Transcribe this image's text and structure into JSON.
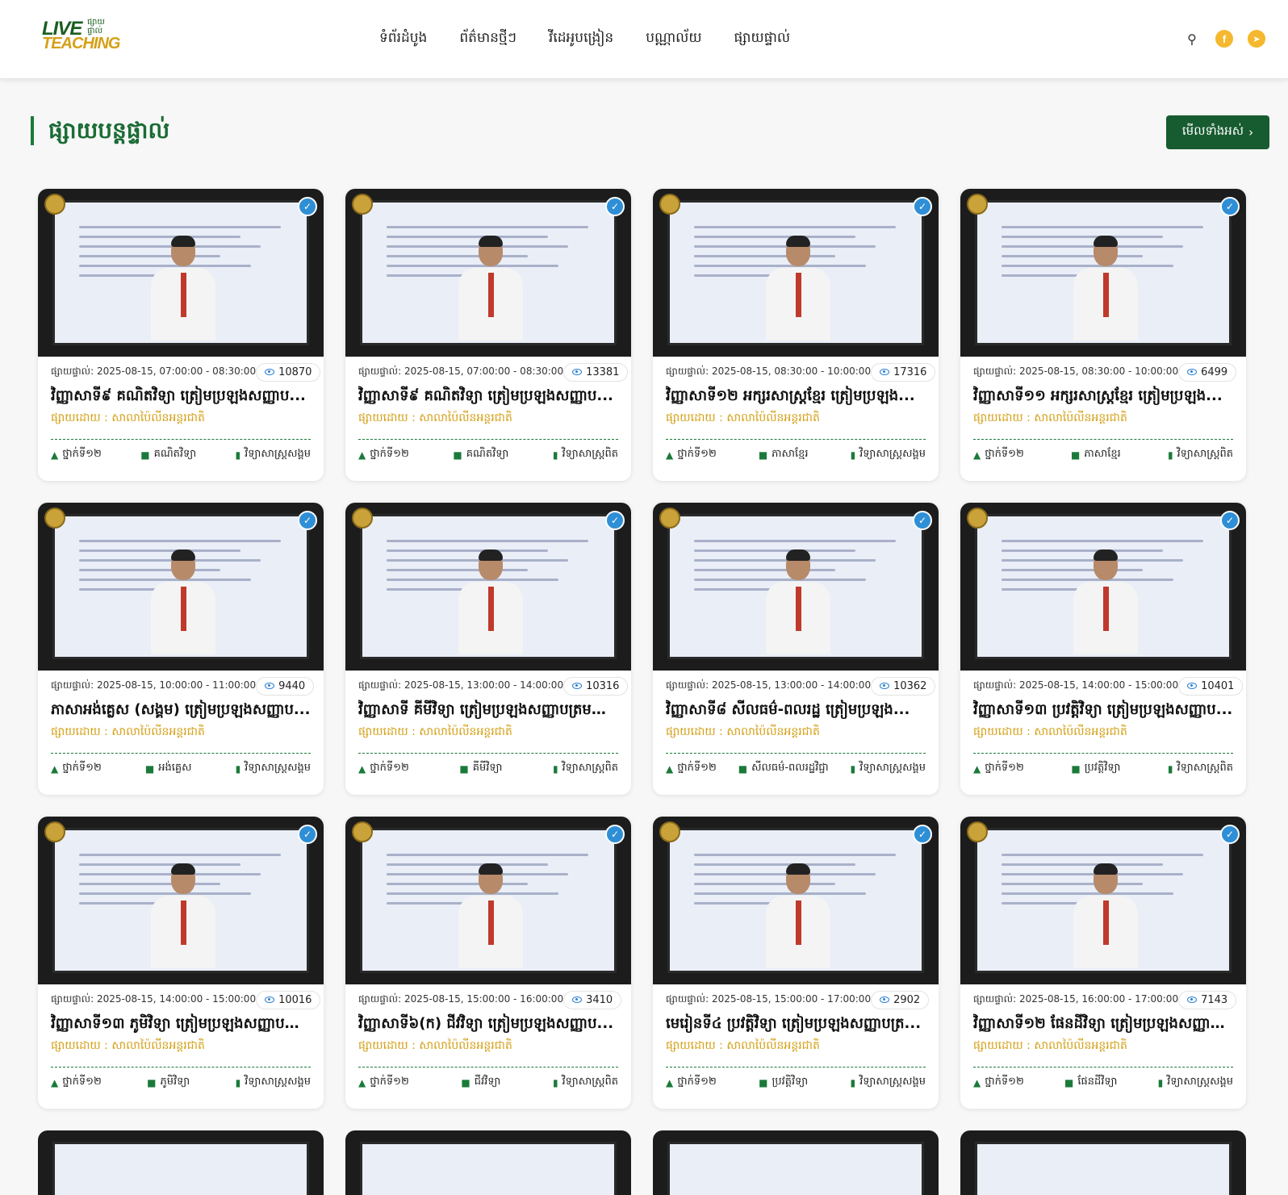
{
  "header": {
    "logo": {
      "line1": "LIVE",
      "line2": "TEACHING",
      "khmer": "ផ្សាយ ផ្ទាល់"
    },
    "nav": [
      "ទំព័រដំបូង",
      "ព័ត៌មានថ្មីៗ",
      "វីដេអូបង្រៀន",
      "បណ្ណាល័យ",
      "ផ្សាយផ្ទាល់"
    ],
    "icons": [
      "search-icon",
      "facebook-icon",
      "telegram-icon"
    ]
  },
  "section": {
    "title": "ផ្សាយបន្តផ្ទាល់",
    "view_all": "មើលទាំងអស់"
  },
  "cards": [
    {
      "time": "ផ្សាយផ្ទាល់: 2025-08-15, 07:00:00 - 08:30:00",
      "views": "10870",
      "title": "វិញ្ញាសាទី៩ គណិតវិទ្យា ត្រៀមប្រឡងសញ្ញាប...",
      "by": "ផ្សាយដោយ : សាលាប៉ៃលីនអន្តរជាតិ",
      "grade": "ថ្នាក់ទី១២",
      "subject": "គណិតវិទ្យា",
      "track": "វិទ្យាសាស្ត្រសង្គម"
    },
    {
      "time": "ផ្សាយផ្ទាល់: 2025-08-15, 07:00:00 - 08:30:00",
      "views": "13381",
      "title": "វិញ្ញាសាទី៩ គណិតវិទ្យា ត្រៀមប្រឡងសញ្ញាប...",
      "by": "ផ្សាយដោយ : សាលាប៉ៃលីនអន្តរជាតិ",
      "grade": "ថ្នាក់ទី១២",
      "subject": "គណិតវិទ្យា",
      "track": "វិទ្យាសាស្ត្រពិត"
    },
    {
      "time": "ផ្សាយផ្ទាល់: 2025-08-15, 08:30:00 - 10:00:00",
      "views": "17316",
      "title": "វិញ្ញាសាទី១២ អក្សរសាស្ត្រខ្មែរ ត្រៀមប្រឡង...",
      "by": "ផ្សាយដោយ : សាលាប៉ៃលីនអន្តរជាតិ",
      "grade": "ថ្នាក់ទី១២",
      "subject": "ភាសាខ្មែរ",
      "track": "វិទ្យាសាស្ត្រសង្គម"
    },
    {
      "time": "ផ្សាយផ្ទាល់: 2025-08-15, 08:30:00 - 10:00:00",
      "views": "6499",
      "title": "វិញ្ញាសាទី១១ អក្សរសាស្ត្រខ្មែរ ត្រៀមប្រឡង...",
      "by": "ផ្សាយដោយ : សាលាប៉ៃលីនអន្តរជាតិ",
      "grade": "ថ្នាក់ទី១២",
      "subject": "ភាសាខ្មែរ",
      "track": "វិទ្យាសាស្ត្រពិត"
    },
    {
      "time": "ផ្សាយផ្ទាល់: 2025-08-15, 10:00:00 - 11:00:00",
      "views": "9440",
      "title": "ភាសាអង់គ្លេស (សង្គម) ត្រៀមប្រឡងសញ្ញាប...",
      "by": "ផ្សាយដោយ : សាលាប៉ៃលីនអន្តរជាតិ",
      "grade": "ថ្នាក់ទី១២",
      "subject": "អង់គ្លេស",
      "track": "វិទ្យាសាស្ត្រសង្គម"
    },
    {
      "time": "ផ្សាយផ្ទាល់: 2025-08-15, 13:00:00 - 14:00:00",
      "views": "10316",
      "title": "វិញ្ញាសាទី គីមីវិទ្យា ត្រៀមប្រឡងសញ្ញាបត្រមធ្យ...",
      "by": "ផ្សាយដោយ : សាលាប៉ៃលីនអន្តរជាតិ",
      "grade": "ថ្នាក់ទី១២",
      "subject": "គីមីវិទ្យា",
      "track": "វិទ្យាសាស្ត្រពិត"
    },
    {
      "time": "ផ្សាយផ្ទាល់: 2025-08-15, 13:00:00 - 14:00:00",
      "views": "10362",
      "title": "វិញ្ញាសាទី៨ សីលធម៌-ពលរដ្ឋ ត្រៀមប្រឡង...",
      "by": "ផ្សាយដោយ : សាលាប៉ៃលីនអន្តរជាតិ",
      "grade": "ថ្នាក់ទី១២",
      "subject": "សីលធម៌-ពលរដ្ឋវិជ្ជា",
      "track": "វិទ្យាសាស្ត្រសង្គម"
    },
    {
      "time": "ផ្សាយផ្ទាល់: 2025-08-15, 14:00:00 - 15:00:00",
      "views": "10401",
      "title": "វិញ្ញាសាទី១៣ ប្រវត្តិវិទ្យា ត្រៀមប្រឡងសញ្ញាប...",
      "by": "ផ្សាយដោយ : សាលាប៉ៃលីនអន្តរជាតិ",
      "grade": "ថ្នាក់ទី១២",
      "subject": "ប្រវត្តិវិទ្យា",
      "track": "វិទ្យាសាស្ត្រពិត"
    },
    {
      "time": "ផ្សាយផ្ទាល់: 2025-08-15, 14:00:00 - 15:00:00",
      "views": "10016",
      "title": "វិញ្ញាសាទី១៣ ភូមិវិទ្យា ត្រៀមប្រឡងសញ្ញាបត្រ...",
      "by": "ផ្សាយដោយ : សាលាប៉ៃលីនអន្តរជាតិ",
      "grade": "ថ្នាក់ទី១២",
      "subject": "ភូមិវិទ្យា",
      "track": "វិទ្យាសាស្ត្រសង្គម"
    },
    {
      "time": "ផ្សាយផ្ទាល់: 2025-08-15, 15:00:00 - 16:00:00",
      "views": "3410",
      "title": "វិញ្ញាសាទី៦(ក) ជីវវិទ្យា ត្រៀមប្រឡងសញ្ញាប...",
      "by": "ផ្សាយដោយ : សាលាប៉ៃលីនអន្តរជាតិ",
      "grade": "ថ្នាក់ទី១២",
      "subject": "ជីវវិទ្យា",
      "track": "វិទ្យាសាស្ត្រពិត"
    },
    {
      "time": "ផ្សាយផ្ទាល់: 2025-08-15, 15:00:00 - 17:00:00",
      "views": "2902",
      "title": "មេរៀនទី៤ ប្រវត្តិវិទ្យា ត្រៀមប្រឡងសញ្ញាបត្រ...",
      "by": "ផ្សាយដោយ : សាលាប៉ៃលីនអន្តរជាតិ",
      "grade": "ថ្នាក់ទី១២",
      "subject": "ប្រវត្តិវិទ្យា",
      "track": "វិទ្យាសាស្ត្រសង្គម"
    },
    {
      "time": "ផ្សាយផ្ទាល់: 2025-08-15, 16:00:00 - 17:00:00",
      "views": "7143",
      "title": "វិញ្ញាសាទី១២ ផែនដីវិទ្យា ត្រៀមប្រឡងសញ្ញាប...",
      "by": "ផ្សាយដោយ : សាលាប៉ៃលីនអន្តរជាតិ",
      "grade": "ថ្នាក់ទី១២",
      "subject": "ផែនដីវិទ្យា",
      "track": "វិទ្យាសាស្ត្រសង្គម"
    }
  ]
}
